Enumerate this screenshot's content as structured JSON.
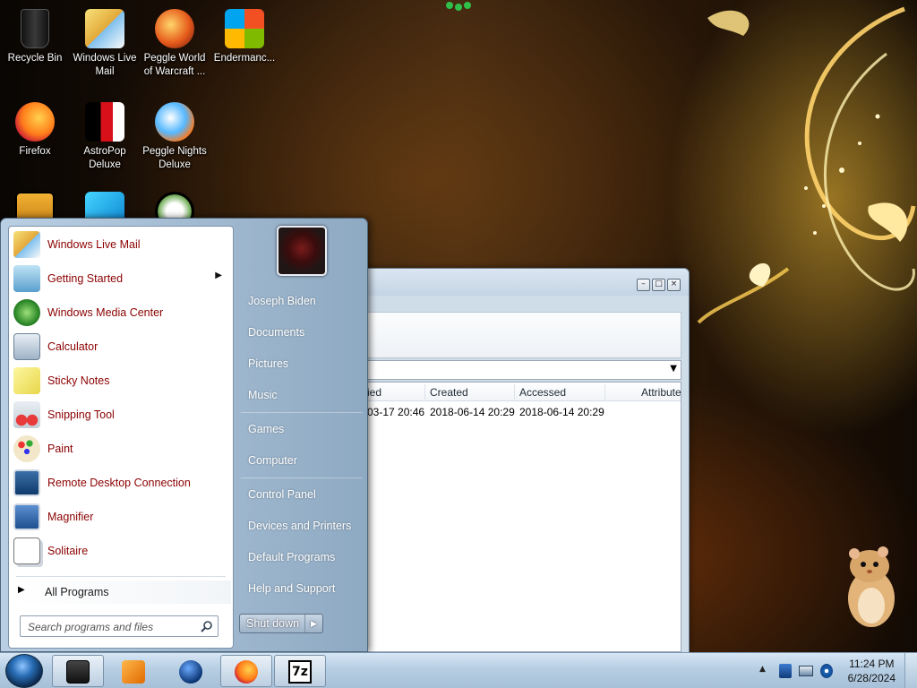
{
  "desktop": {
    "icons": [
      {
        "label": "Recycle Bin",
        "icon": "recycle-bin-icon"
      },
      {
        "label": "Windows Live Mail",
        "icon": "mail-icon"
      },
      {
        "label": "Peggle World of Warcraft ...",
        "icon": "peggle-icon"
      },
      {
        "label": "Endermanc...",
        "icon": "windows-logo-icon"
      },
      {
        "label": "Firefox",
        "icon": "firefox-icon"
      },
      {
        "label": "AstroPop Deluxe",
        "icon": "astropop-icon"
      },
      {
        "label": "Peggle Nights Deluxe",
        "icon": "peggle-nights-icon"
      }
    ]
  },
  "background_window": {
    "columns": [
      {
        "label": "ied"
      },
      {
        "label": "Created"
      },
      {
        "label": "Accessed"
      },
      {
        "label": "Attribute"
      }
    ],
    "row": {
      "modified": "03-17 20:46",
      "created": "2018-06-14 20:29",
      "accessed": "2018-06-14 20:29"
    }
  },
  "start_menu": {
    "programs": [
      {
        "label": "Windows Live Mail",
        "icon": "mail-icon"
      },
      {
        "label": "Getting Started",
        "icon": "getting-started-icon",
        "has_submenu": true
      },
      {
        "label": "Windows Media Center",
        "icon": "media-center-icon"
      },
      {
        "label": "Calculator",
        "icon": "calculator-icon"
      },
      {
        "label": "Sticky Notes",
        "icon": "sticky-notes-icon"
      },
      {
        "label": "Snipping Tool",
        "icon": "scissors-icon"
      },
      {
        "label": "Paint",
        "icon": "paint-icon"
      },
      {
        "label": "Remote Desktop Connection",
        "icon": "remote-desktop-icon"
      },
      {
        "label": "Magnifier",
        "icon": "magnifier-icon"
      },
      {
        "label": "Solitaire",
        "icon": "solitaire-icon"
      }
    ],
    "all_programs": "All Programs",
    "search_placeholder": "Search programs and files",
    "right_items": [
      {
        "label": "Joseph Biden"
      },
      {
        "label": "Documents"
      },
      {
        "label": "Pictures"
      },
      {
        "label": "Music"
      },
      {
        "label": "Games"
      },
      {
        "label": "Computer"
      },
      {
        "label": "Control Panel"
      },
      {
        "label": "Devices and Printers"
      },
      {
        "label": "Default Programs"
      },
      {
        "label": "Help and Support"
      }
    ],
    "shutdown_label": "Shut down"
  },
  "taskbar": {
    "pinned": [
      {
        "icon": "pc-icon"
      },
      {
        "icon": "media-player-icon"
      },
      {
        "icon": "globe-icon"
      },
      {
        "icon": "firefox-icon"
      },
      {
        "icon": "7zip-icon",
        "text": "7z"
      }
    ],
    "clock": {
      "time": "11:24 PM",
      "date": "6/28/2024"
    }
  }
}
